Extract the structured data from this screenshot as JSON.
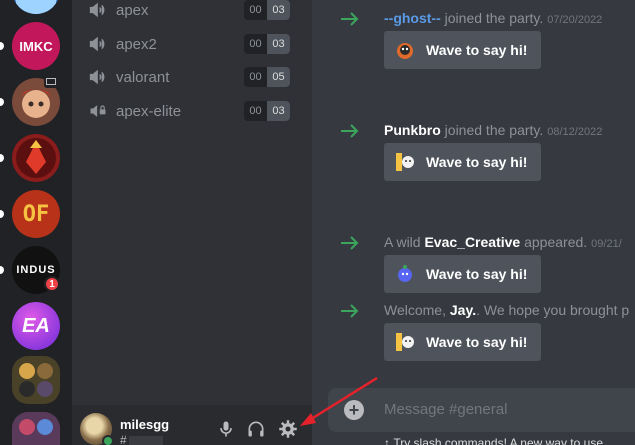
{
  "servers": [
    {
      "icon": "blue-server-icon",
      "color": "#4a8fd8"
    },
    {
      "label": "IMKC",
      "color": "#c2185b"
    },
    {
      "icon": "anime-server-icon",
      "color": "#7a4a3a"
    },
    {
      "icon": "red-emblem-server-icon",
      "color": "#8b1c1c"
    },
    {
      "label": "OF",
      "color": "#b8321a"
    },
    {
      "label": "INDUS",
      "color": "#111111",
      "badge": "1"
    },
    {
      "label": "EA",
      "color": "#a23de0"
    },
    {
      "icon": "folder-server-icon",
      "color": "#4a4228"
    },
    {
      "icon": "partial-server-icon",
      "color": "#5a3a5a"
    }
  ],
  "voice_channels": [
    {
      "name": "apex",
      "count_a": "00",
      "count_b": "03"
    },
    {
      "name": "apex2",
      "count_a": "00",
      "count_b": "03"
    },
    {
      "name": "valorant",
      "count_a": "00",
      "count_b": "05"
    },
    {
      "name": "apex-elite",
      "count_a": "00",
      "count_b": "03"
    }
  ],
  "user": {
    "name": "milesgg",
    "tag": "#"
  },
  "messages": [
    {
      "user": "--ghost--",
      "suffix": " joined the party.",
      "time": "07/20/2022",
      "wave": "Wave to say hi!"
    },
    {
      "user": "Punkbro",
      "suffix": " joined the party.",
      "time": "08/12/2022",
      "wave": "Wave to say hi!"
    },
    {
      "prefix": "A wild ",
      "user": "Evac_Creative",
      "suffix": " appeared.",
      "time": "09/21/",
      "wave": "Wave to say hi!"
    },
    {
      "prefix": "Welcome, ",
      "user": "Jay.",
      "suffix": ". We hope you brought p",
      "wave": "Wave to say hi!"
    }
  ],
  "composer": {
    "placeholder": "Message #general"
  },
  "hint": "Try slash commands! A new way to use",
  "colors": {
    "online": "#3ba55c",
    "arrow": "#3ba55c",
    "annotation": "#e5222b"
  }
}
